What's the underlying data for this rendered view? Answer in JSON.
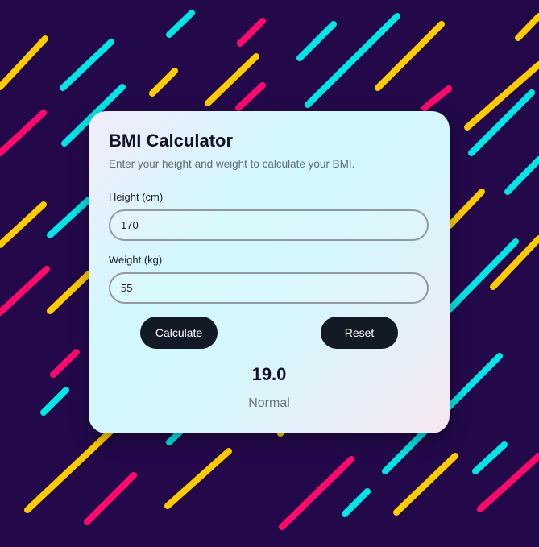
{
  "colors": {
    "background": "#23094a",
    "stripe_yellow": "#ffcc00",
    "stripe_cyan": "#00e5e5",
    "stripe_pink": "#ff0a6c",
    "button": "#121a26"
  },
  "calculator": {
    "title": "BMI Calculator",
    "subtitle": "Enter your height and weight to calculate your BMI.",
    "height": {
      "label": "Height (cm)",
      "value": "170"
    },
    "weight": {
      "label": "Weight (kg)",
      "value": "55"
    },
    "calculate_label": "Calculate",
    "reset_label": "Reset",
    "result": {
      "value": "19.0",
      "category": "Normal"
    }
  }
}
